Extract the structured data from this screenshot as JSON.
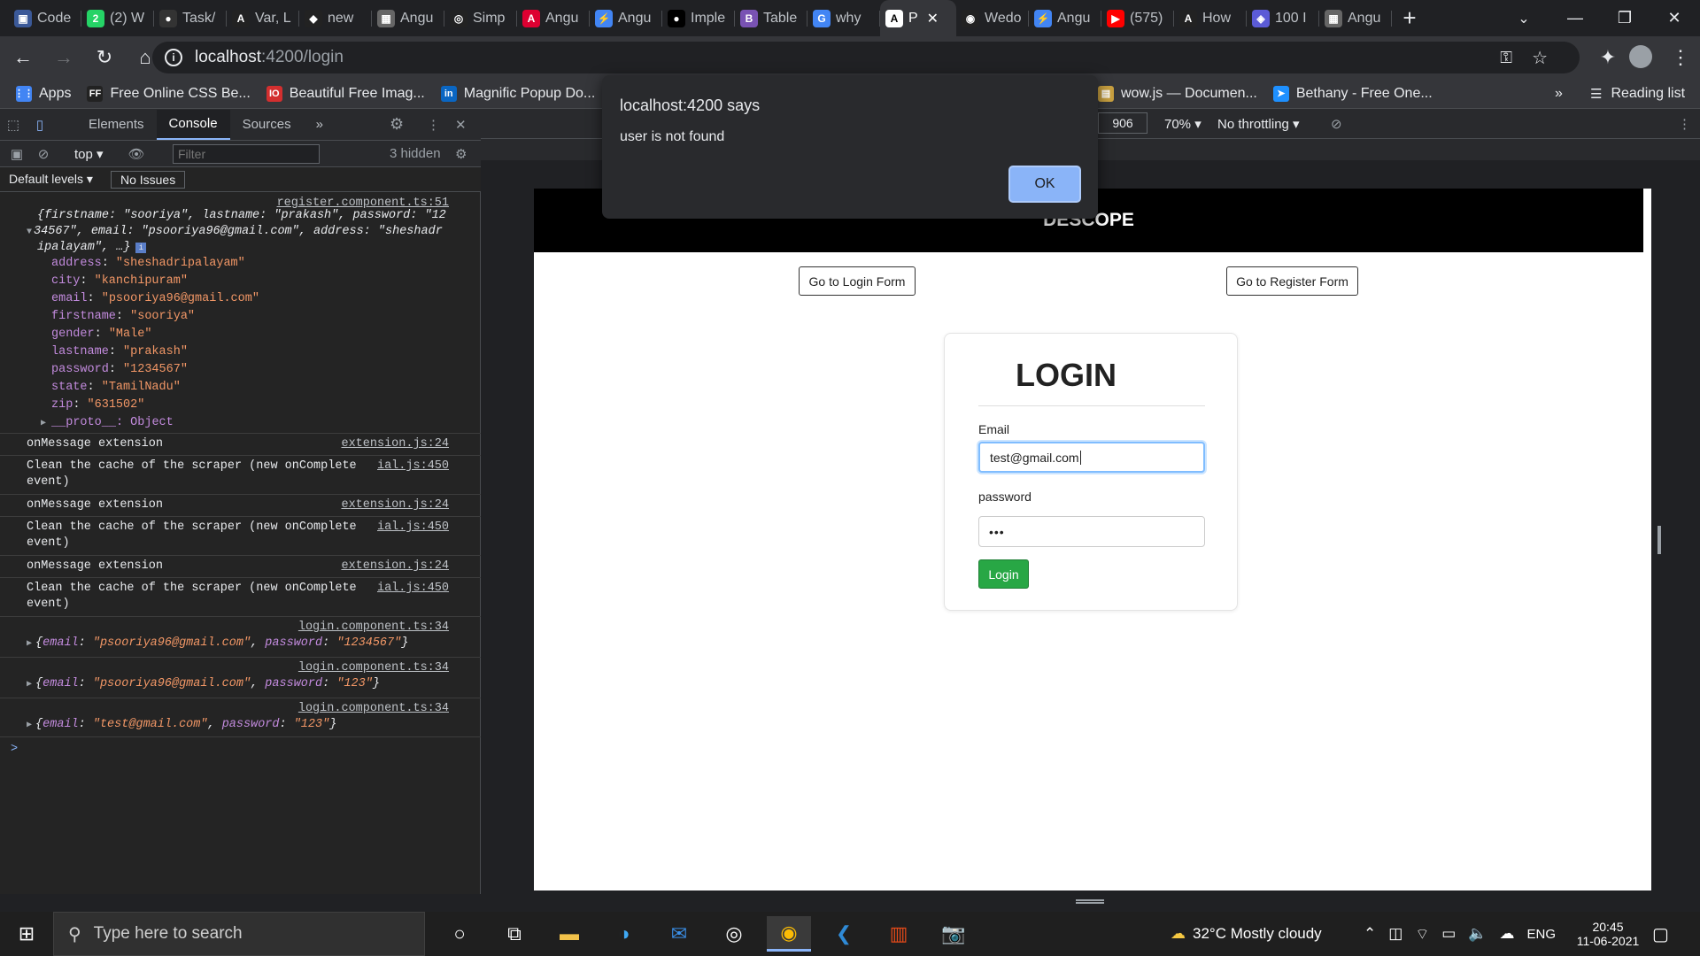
{
  "tabs": [
    {
      "label": "Code",
      "color": "#3b5998",
      "glyph": "▣"
    },
    {
      "label": "(2) W",
      "color": "#25d366",
      "glyph": "2"
    },
    {
      "label": "Task/",
      "color": "#333333",
      "glyph": "●"
    },
    {
      "label": "Var, L",
      "color": "#222222",
      "glyph": "A"
    },
    {
      "label": "new",
      "color": "#222222",
      "glyph": "◆"
    },
    {
      "label": "Angu",
      "color": "#666666",
      "glyph": "▦"
    },
    {
      "label": "Simp",
      "color": "#222222",
      "glyph": "◎"
    },
    {
      "label": "Angu",
      "color": "#dd0031",
      "glyph": "A"
    },
    {
      "label": "Angu",
      "color": "#4285f4",
      "glyph": "⚡"
    },
    {
      "label": "Imple",
      "color": "#000000",
      "glyph": "●"
    },
    {
      "label": "Table",
      "color": "#7952b3",
      "glyph": "B"
    },
    {
      "label": "why",
      "color": "#4285f4",
      "glyph": "G"
    },
    {
      "label": "P",
      "color": "#ffffff",
      "glyph": "A",
      "active": true
    },
    {
      "label": "Wedo",
      "color": "#222222",
      "glyph": "◉"
    },
    {
      "label": "Angu",
      "color": "#4285f4",
      "glyph": "⚡"
    },
    {
      "label": "(575)",
      "color": "#ff0000",
      "glyph": "▶"
    },
    {
      "label": "How",
      "color": "#222222",
      "glyph": "A"
    },
    {
      "label": "100 I",
      "color": "#5b5bd6",
      "glyph": "◈"
    },
    {
      "label": "Angu",
      "color": "#666666",
      "glyph": "▦"
    }
  ],
  "omnibox": {
    "host": "localhost",
    "path": ":4200/login"
  },
  "bookmarks": [
    {
      "label": "Apps",
      "color": "#4285f4",
      "glyph": "⋮⋮"
    },
    {
      "label": "Free Online CSS Be...",
      "color": "#222222",
      "glyph": "FF"
    },
    {
      "label": "Beautiful Free Imag...",
      "color": "#d32f2f",
      "glyph": "IO"
    },
    {
      "label": "Magnific Popup Do...",
      "color": "#0a66c2",
      "glyph": "in"
    },
    {
      "label": "",
      "color": "#555555",
      "glyph": "◐"
    }
  ],
  "bookmarks_right": [
    {
      "label": "wow.js — Documen...",
      "color": "#c8a040",
      "glyph": "▤"
    },
    {
      "label": "Bethany - Free One...",
      "color": "#1e90ff",
      "glyph": "➤"
    }
  ],
  "reading_list": "Reading list",
  "overflow": "»",
  "devtools": {
    "tabs": [
      "Elements",
      "Console",
      "Sources"
    ],
    "more": "»",
    "context": "top",
    "filter_placeholder": "Filter",
    "hidden": "3 hidden",
    "levels": "Default levels",
    "issues": "No Issues",
    "logs": [
      {
        "src": "register.component.ts:51"
      },
      {
        "text": "{firstname: \"sooriya\", lastname: \"prakash\", password: \"12"
      },
      {
        "text": "34567\", email: \"psooriya96@gmail.com\", address: \"sheshadr"
      },
      {
        "text": "ipalayam\", …}"
      }
    ],
    "props": [
      {
        "k": "address",
        "v": "\"sheshadripalayam\""
      },
      {
        "k": "city",
        "v": "\"kanchipuram\""
      },
      {
        "k": "email",
        "v": "\"psooriya96@gmail.com\""
      },
      {
        "k": "firstname",
        "v": "\"sooriya\""
      },
      {
        "k": "gender",
        "v": "\"Male\""
      },
      {
        "k": "lastname",
        "v": "\"prakash\""
      },
      {
        "k": "password",
        "v": "\"1234567\""
      },
      {
        "k": "state",
        "v": "\"TamilNadu\""
      },
      {
        "k": "zip",
        "v": "\"631502\""
      }
    ],
    "proto": "__proto__: Object",
    "messages": [
      {
        "text": "onMessage extension",
        "src": "extension.js:24"
      },
      {
        "text": "Clean the cache of the scraper (new onComplete",
        "text2": "event)",
        "src": "ial.js:450"
      },
      {
        "text": "onMessage extension",
        "src": "extension.js:24"
      },
      {
        "text": "Clean the cache of the scraper (new onComplete",
        "text2": "event)",
        "src": "ial.js:450"
      },
      {
        "text": "onMessage extension",
        "src": "extension.js:24"
      },
      {
        "text": "Clean the cache of the scraper (new onComplete",
        "text2": "event)",
        "src": "ial.js:450"
      }
    ],
    "login_logs": [
      {
        "src": "login.component.ts:34",
        "email": "\"psooriya96@gmail.com\"",
        "password": "\"1234567\""
      },
      {
        "src": "login.component.ts:34",
        "email": "\"psooriya96@gmail.com\"",
        "password": "\"123\""
      },
      {
        "src": "login.component.ts:34",
        "email": "\"test@gmail.com\"",
        "password": "\"123\""
      }
    ],
    "prompt": ">"
  },
  "viewport": {
    "height": "906",
    "zoom": "70%",
    "throttling": "No throttling"
  },
  "page": {
    "header": "DESCOPE",
    "login_form_btn": "Go to Login Form",
    "register_form_btn": "Go to Register Form",
    "title": "LOGIN",
    "email_label": "Email",
    "email_value": "test@gmail.com",
    "password_label": "password",
    "password_value": "•••",
    "login_btn": "Login"
  },
  "alert": {
    "title": "localhost:4200 says",
    "message": "user is not found",
    "ok": "OK"
  },
  "taskbar": {
    "search_placeholder": "Type here to search",
    "weather": "32°C  Mostly cloudy",
    "lang": "ENG",
    "time": "20:45",
    "date": "11-06-2021"
  }
}
